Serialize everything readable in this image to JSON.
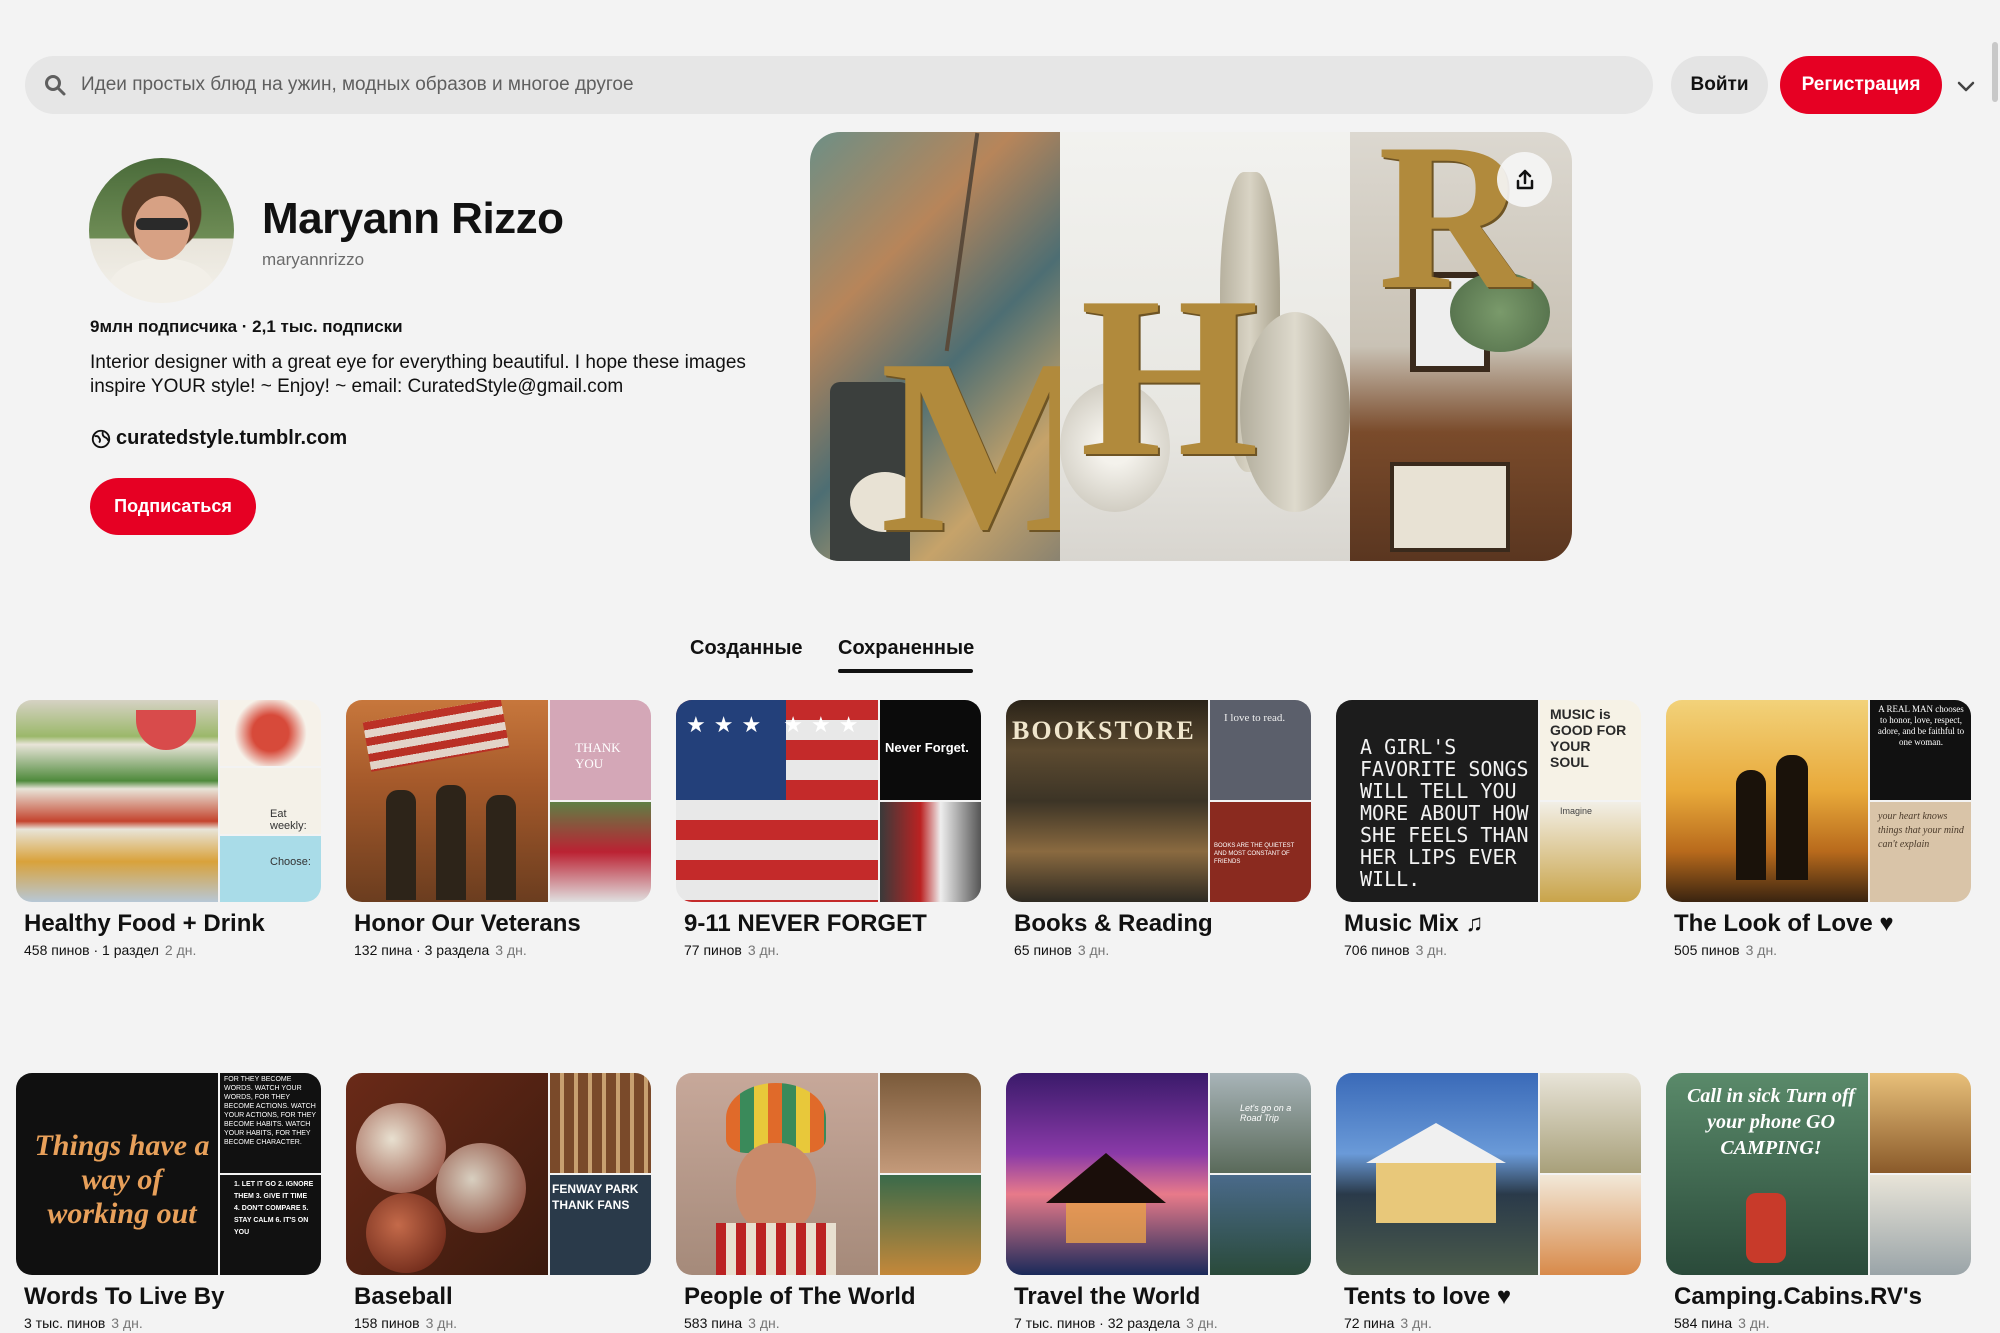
{
  "header": {
    "search_placeholder": "Идеи простых блюд на ужин, модных образов и многое другое",
    "login_label": "Войти",
    "register_label": "Регистрация"
  },
  "profile": {
    "name": "Maryann Rizzo",
    "handle": "maryannrizzo",
    "stats": "9млн подписчика · 2,1 тыс. подписки",
    "bio": "Interior designer with a great eye for everything beautiful. I hope these images inspire YOUR style! ~ Enjoy! ~ email: CuratedStyle@gmail.com",
    "website": "curatedstyle.tumblr.com",
    "follow_label": "Подписаться",
    "cover_letters": [
      "M",
      "H",
      "R"
    ]
  },
  "tabs": [
    {
      "label": "Созданные",
      "active": false
    },
    {
      "label": "Сохраненные",
      "active": true
    }
  ],
  "boards": [
    {
      "title": "Healthy Food + Drink",
      "meta": "458 пинов · 1 раздел",
      "ago": "2 дн.",
      "overlay_side": [
        "",
        "Eat weekly:",
        "Choose:"
      ]
    },
    {
      "title": "Honor Our Veterans",
      "meta": "132 пина · 3 раздела",
      "ago": "3 дн.",
      "overlay_side": [
        "THANK YOU",
        "",
        ""
      ]
    },
    {
      "title": "9-11 NEVER FORGET",
      "meta": "77 пинов",
      "ago": "3 дн.",
      "overlay_side": [
        "Never Forget.",
        "",
        ""
      ]
    },
    {
      "title": "Books & Reading",
      "meta": "65 пинов",
      "ago": "3 дн.",
      "overlay_main": "BOOKSTORE",
      "overlay_side": [
        "I love to read.",
        "BOOKS ARE THE QUIETEST AND MOST CONSTANT OF FRIENDS",
        ""
      ]
    },
    {
      "title": "Music Mix ♫",
      "meta": "706 пинов",
      "ago": "3 дн.",
      "overlay_main": "A GIRL'S FAVORITE SONGS WILL TELL YOU MORE ABOUT HOW SHE FEELS THAN HER LIPS EVER WILL.",
      "overlay_side": [
        "MUSIC is GOOD FOR YOUR SOUL",
        "Imagine",
        ""
      ]
    },
    {
      "title": "The Look of Love ♥",
      "meta": "505 пинов",
      "ago": "3 дн.",
      "overlay_side": [
        "A REAL MAN chooses to honor, love, respect, adore, and be faithful to one woman.",
        "your heart knows things that your mind can't explain",
        ""
      ]
    },
    {
      "title": "Words To Live By",
      "meta": "3 тыс. пинов",
      "ago": "3 дн.",
      "overlay_main": "Things have a way of working out",
      "overlay_side": [
        "FOR THEY BECOME WORDS. WATCH YOUR WORDS, FOR THEY BECOME ACTIONS. WATCH YOUR ACTIONS, FOR THEY BECOME HABITS. WATCH YOUR HABITS, FOR THEY BECOME CHARACTER.",
        "1. LET IT GO 2. IGNORE THEM 3. GIVE IT TIME 4. DON'T COMPARE 5. STAY CALM 6. IT'S ON YOU",
        ""
      ]
    },
    {
      "title": "Baseball",
      "meta": "158 пинов",
      "ago": "3 дн.",
      "overlay_side": [
        "",
        "FENWAY PARK THANK FANS",
        ""
      ]
    },
    {
      "title": "People of The World",
      "meta": "583 пина",
      "ago": "3 дн.",
      "overlay_side": [
        "",
        "",
        ""
      ]
    },
    {
      "title": "Travel the World",
      "meta": "7 тыс. пинов · 32 раздела",
      "ago": "3 дн.",
      "overlay_side": [
        "Let's go on a Road Trip",
        "",
        ""
      ]
    },
    {
      "title": "Tents to love ♥",
      "meta": "72 пина",
      "ago": "3 дн.",
      "overlay_side": [
        "",
        "",
        ""
      ]
    },
    {
      "title": "Camping.Cabins.RV's",
      "meta": "584 пина",
      "ago": "3 дн.",
      "overlay_main": "Call in sick Turn off your phone GO CAMPING!",
      "overlay_side": [
        "",
        "",
        ""
      ]
    }
  ]
}
